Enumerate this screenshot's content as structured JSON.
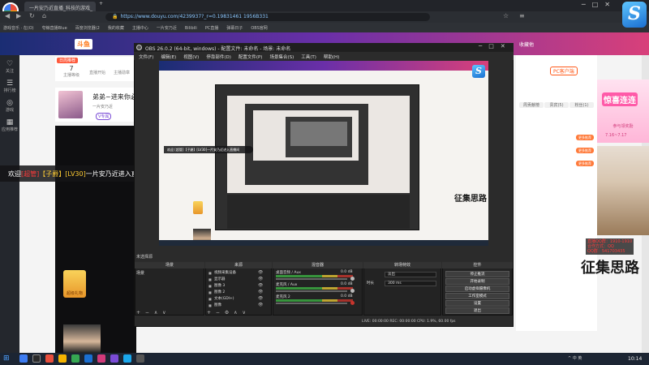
{
  "browser": {
    "tab_title": "一片安乃近直播_科技的游戏_",
    "new_tab": "+",
    "url": "https://www.douyu.com/4239937?_r=0.19831461 1956B331",
    "bookmarks": [
      "游戏音乐 · 在(O)",
      "夸鲸直播Blue",
      "百度浏览器(2",
      "我的收藏",
      "主播中心",
      "一片安乃近",
      "Bilibili",
      "PC直播",
      "弹幕日子",
      "OBS官网"
    ]
  },
  "douyu": {
    "logo": "斗鱼",
    "fav_label": "收藏他",
    "sidebar": [
      {
        "icon": "heart-icon",
        "label": "关注"
      },
      {
        "icon": "list-icon",
        "label": "排行榜"
      },
      {
        "icon": "gamepad-icon",
        "label": "游戏"
      },
      {
        "icon": "grid-icon",
        "label": "应用推荐"
      }
    ],
    "rank_tag": "日周推荐",
    "stats": [
      {
        "value": "7",
        "label": "主播等级"
      },
      {
        "value": "",
        "label": "直播开始"
      },
      {
        "value": "",
        "label": "主播勋章"
      }
    ],
    "anchor_name": "弟弟~进来你必",
    "anchor_sub": "一片安乃近",
    "anchor_badge": "V专属",
    "welcome": {
      "prefix": "欢迎",
      "user": "[超管]",
      "rank": "【子爵】",
      "level": "[LV30]",
      "suffix": "一片安乃近进入直播间"
    },
    "gift_label": "超级礼物",
    "pc_client": "PC客户端",
    "right_tabs": [
      "周贡献榜",
      "贵宾(5)",
      "粉丝(1)"
    ],
    "right_buttons": [
      "更多推荐",
      "更多推荐",
      "更多推荐"
    ],
    "ad_title": "惊喜连连",
    "ad_date": "7.16~7.17",
    "ad_sub": "参与领奖励",
    "watermark": "征集思路",
    "qq_info": [
      "直播QQ群：1910-1910",
      "合作方式：QQ",
      "QQ群：541703435"
    ]
  },
  "obs": {
    "title": "OBS 26.0.2 (64-bit, windows) - 配置文件: 未命名 - 场景: 未命名",
    "menu": [
      "文件(F)",
      "编辑(E)",
      "视图(V)",
      "停靠部件(D)",
      "配置文件(P)",
      "场景集合(S)",
      "工具(T)",
      "帮助(H)"
    ],
    "scene_label": "未选择源",
    "docks": {
      "scenes": "场景",
      "sources": "来源",
      "mixer": "混音器",
      "transitions": "转场特效",
      "controls": "控件"
    },
    "scene_item": "场景",
    "sources": [
      "视频采集设备",
      "显示器",
      "图像 3",
      "图像 2",
      "文本(GDI+)",
      "图像"
    ],
    "mixer": [
      {
        "name": "桌面音频 / Aux",
        "db": "0.0 dB"
      },
      {
        "name": "麦克风 / Aux",
        "db": "0.0 dB"
      },
      {
        "name": "麦克风 2",
        "db": "0.0 dB"
      }
    ],
    "transitions": {
      "type_label": "淡出",
      "duration_label": "时长",
      "duration": "300 ms"
    },
    "controls": [
      "停止推流",
      "开始录制",
      "启动虚拟摄像机",
      "工作室模式",
      "设置",
      "退出"
    ],
    "status": "LIVE: 00:00:00    REC: 00:00:00    CPU: 1.9%, 60.00 fps",
    "nested_welcome": "欢迎 [超管]【子爵】[LV30]一片安乃近进入直播间"
  },
  "taskbar": {
    "start": "⊞",
    "tray": "^ 中 英",
    "clock": "10:14"
  }
}
